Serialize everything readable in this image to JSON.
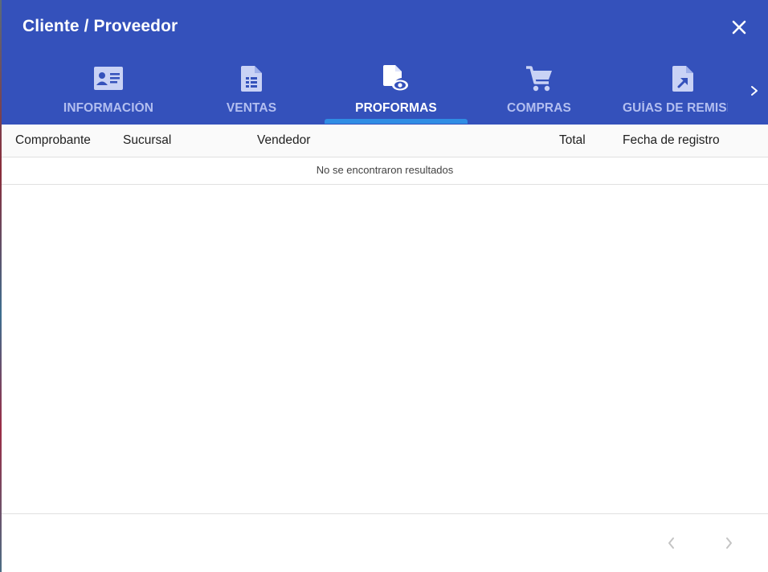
{
  "dialog": {
    "title": "Cliente / Proveedor",
    "close_icon": "close-icon"
  },
  "tabs": [
    {
      "label": "INFORMACIÓN",
      "icon": "id-card-icon",
      "active": false
    },
    {
      "label": "VENTAS",
      "icon": "invoice-document-icon",
      "active": false
    },
    {
      "label": "PROFORMAS",
      "icon": "document-eye-icon",
      "active": true
    },
    {
      "label": "COMPRAS",
      "icon": "shopping-cart-icon",
      "active": false
    },
    {
      "label": "GUÍAS DE REMISIÓN",
      "icon": "document-arrow-icon",
      "active": false
    }
  ],
  "table": {
    "columns": [
      "Comprobante",
      "Sucursal",
      "Vendedor",
      "Total",
      "Fecha de registro"
    ],
    "empty_message": "No se encontraron resultados"
  },
  "pagination": {
    "prev_icon": "chevron-left-icon",
    "next_icon": "chevron-right-icon"
  },
  "colors": {
    "header_bg": "#3451bb",
    "active_indicator": "#2f8de4",
    "inactive_tab_text": "#b3bff0"
  }
}
